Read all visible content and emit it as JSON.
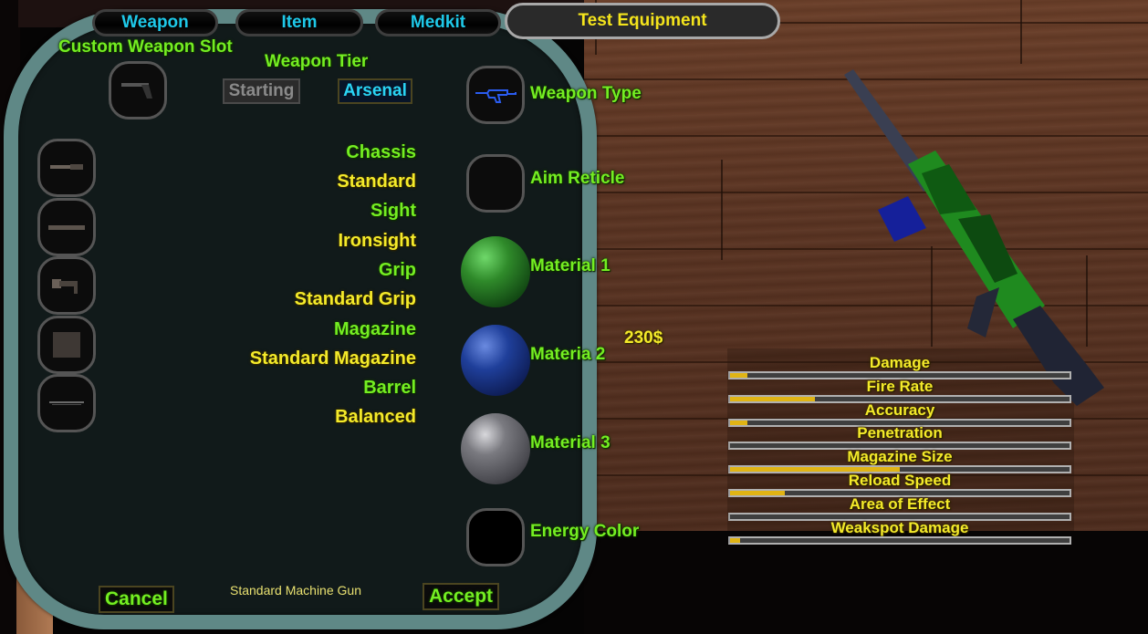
{
  "tabs": [
    {
      "label": "Weapon",
      "active": false
    },
    {
      "label": "Item",
      "active": false
    },
    {
      "label": "Medkit",
      "active": false
    },
    {
      "label": "Test Equipment",
      "active": true
    }
  ],
  "custom_weapon_slot": {
    "label": "Custom Weapon Slot",
    "icon": "pistol-icon"
  },
  "weapon_tier": {
    "label": "Weapon Tier",
    "options": [
      {
        "label": "Starting",
        "selected": false
      },
      {
        "label": "Arsenal",
        "selected": true
      }
    ]
  },
  "part_slots": [
    {
      "icon": "chassis-part-icon"
    },
    {
      "icon": "sight-part-icon"
    },
    {
      "icon": "grip-part-icon"
    },
    {
      "icon": "magazine-part-icon"
    },
    {
      "icon": "barrel-part-icon"
    }
  ],
  "parts": [
    {
      "category": "Chassis",
      "value": "Standard"
    },
    {
      "category": "Sight",
      "value": "Ironsight"
    },
    {
      "category": "Grip",
      "value": "Standard Grip"
    },
    {
      "category": "Magazine",
      "value": "Standard Magazine"
    },
    {
      "category": "Barrel",
      "value": "Balanced"
    }
  ],
  "customization": [
    {
      "label": "Weapon Type",
      "kind": "slot",
      "icon": "assault-rifle-icon"
    },
    {
      "label": "Aim Reticle",
      "kind": "slot",
      "icon": "empty"
    },
    {
      "label": "Material 1",
      "kind": "sphere",
      "color": "#2f8a2a"
    },
    {
      "label": "Materia 2",
      "kind": "sphere",
      "color": "#1f3f9a"
    },
    {
      "label": "Material 3",
      "kind": "sphere",
      "color": "#6a6a70"
    },
    {
      "label": "Energy Color",
      "kind": "slot",
      "icon": "empty"
    }
  ],
  "price": "230$",
  "stats": [
    {
      "label": "Damage",
      "value": 0.05
    },
    {
      "label": "Fire Rate",
      "value": 0.25
    },
    {
      "label": "Accuracy",
      "value": 0.05
    },
    {
      "label": "Penetration",
      "value": 0.0
    },
    {
      "label": "Magazine Size",
      "value": 0.5
    },
    {
      "label": "Reload Speed",
      "value": 0.16
    },
    {
      "label": "Area of Effect",
      "value": 0.0
    },
    {
      "label": "Weakspot Damage",
      "value": 0.03
    }
  ],
  "footer": {
    "cancel_label": "Cancel",
    "weapon_name": "Standard Machine Gun",
    "accept_label": "Accept"
  },
  "colors": {
    "label_green": "#74ee22",
    "label_yellow": "#f4ea2a",
    "tab_cyan": "#1ec8e8",
    "bar_fill": "#e0b414",
    "panel_frame": "#5f8886"
  }
}
